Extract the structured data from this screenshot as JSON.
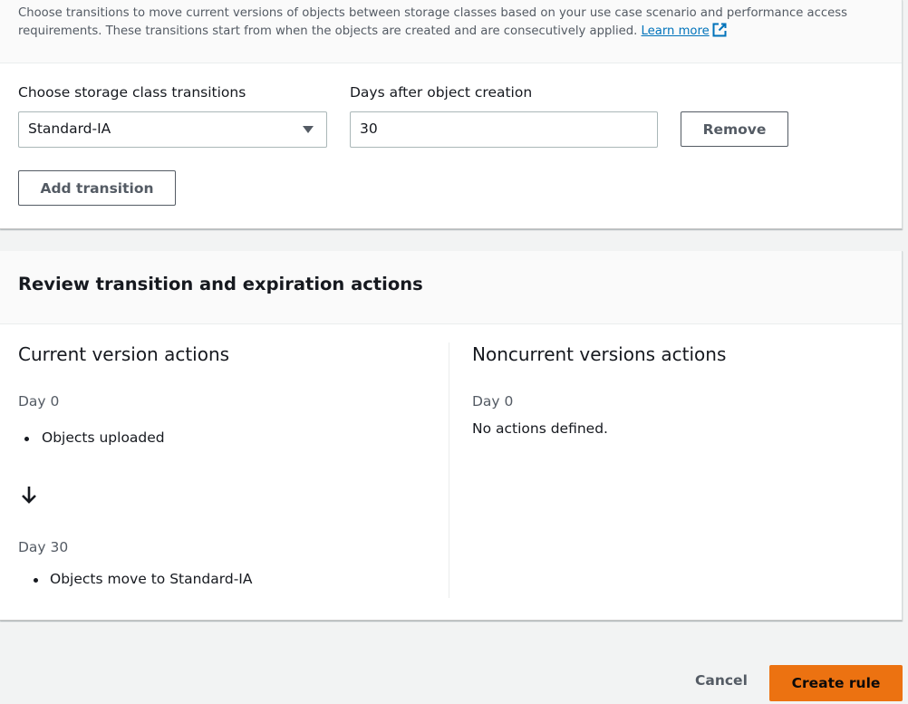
{
  "transitions_panel": {
    "description": "Choose transitions to move current versions of objects between storage classes based on your use case scenario and performance access requirements. These transitions start from when the objects are created and are consecutively applied.",
    "learn_more_label": "Learn more",
    "storage_class_label": "Choose storage class transitions",
    "storage_class_value": "Standard-IA",
    "days_label": "Days after object creation",
    "days_value": "30",
    "remove_label": "Remove",
    "add_transition_label": "Add transition"
  },
  "review_panel": {
    "title": "Review transition and expiration actions",
    "current": {
      "title": "Current version actions",
      "steps": [
        {
          "day": "Day 0",
          "action": "Objects uploaded"
        },
        {
          "day": "Day 30",
          "action": "Objects move to Standard-IA"
        }
      ]
    },
    "noncurrent": {
      "title": "Noncurrent versions actions",
      "day": "Day 0",
      "message": "No actions defined."
    }
  },
  "footer": {
    "cancel_label": "Cancel",
    "create_label": "Create rule"
  },
  "colors": {
    "primary": "#ec7211",
    "link": "#0073bb",
    "background": "#f2f3f3"
  },
  "icons": [
    "external-link-icon",
    "caret-down-icon",
    "arrow-down-icon"
  ]
}
